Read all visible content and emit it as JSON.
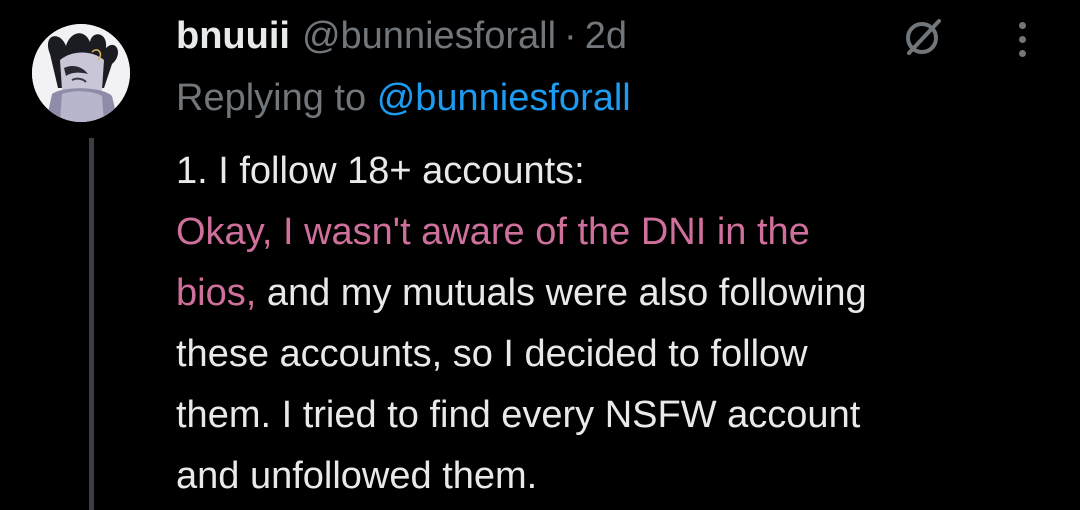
{
  "tweet": {
    "display_name": "bnuuii",
    "handle": "@bunniesforall",
    "separator": "·",
    "timestamp": "2d",
    "replying_prefix": "Replying to",
    "replying_to": "@bunniesforall",
    "body_lines": {
      "l1": "1. I follow 18+ accounts:",
      "l2": "Okay, I wasn't aware of the DNI in the",
      "l3_pink": "bios, ",
      "l3_rest": "and my mutuals were also following",
      "l4": "these accounts, so I decided to follow",
      "l5": "them. I tried to find every NSFW account",
      "l6": "and unfollowed them."
    }
  },
  "icons": {
    "avatar": "avatar-image",
    "grok": "grok-icon",
    "more": "more-options-icon"
  },
  "colors": {
    "background": "#000000",
    "primary_text": "#e7e9ea",
    "secondary_text": "#71767b",
    "mention": "#1d9bf0",
    "highlight_pink": "#cf6f9b",
    "thread_line": "#3a3d41"
  }
}
